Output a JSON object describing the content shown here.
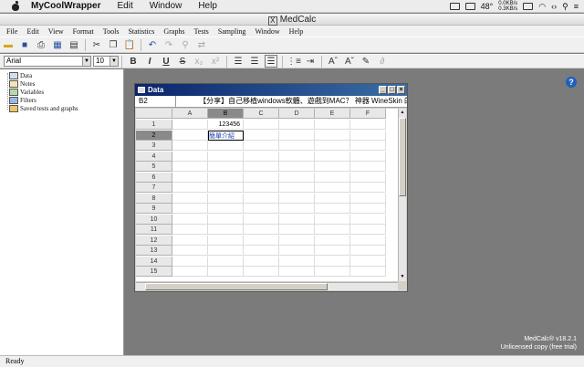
{
  "mac_menu": {
    "app_name": "MyCoolWrapper",
    "items": [
      "Edit",
      "Window",
      "Help"
    ],
    "temp": "48°",
    "net_up": "0.0KB/s",
    "net_down": "0.3KB/s"
  },
  "window_title": "MedCalc",
  "app_menu": [
    "File",
    "Edit",
    "View",
    "Format",
    "Tools",
    "Statistics",
    "Graphs",
    "Tests",
    "Sampling",
    "Window",
    "Help"
  ],
  "toolbar": {
    "font_name": "Arial",
    "font_size": "10"
  },
  "tree": {
    "items": [
      "Data",
      "Notes",
      "Variables",
      "Filters",
      "Saved tests and graphs"
    ]
  },
  "data_window": {
    "title": "Data",
    "cell_ref": "B2",
    "formula_value": "【分享】自己移植windows軟體、遊戲到MAC？ 神器 WineSkin 的",
    "columns": [
      "A",
      "B",
      "C",
      "D",
      "E",
      "F"
    ],
    "rows": [
      "1",
      "2",
      "3",
      "4",
      "5",
      "6",
      "7",
      "8",
      "9",
      "10",
      "11",
      "12",
      "13",
      "14",
      "15"
    ],
    "cells": {
      "B1": "123456",
      "B2": "簡單介紹"
    }
  },
  "status": "Ready",
  "version": {
    "line1": "MedCalc® v18.2.1",
    "line2": "Unlicensed copy (free trial)"
  },
  "colors": {
    "caption_start": "#0a246a",
    "caption_end": "#3a6ea5",
    "workspace": "#7b7b7b"
  }
}
